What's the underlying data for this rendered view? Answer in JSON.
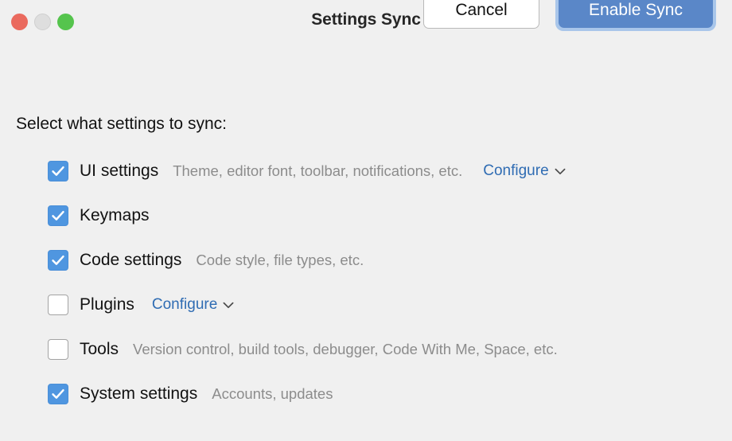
{
  "window": {
    "title": "Settings Sync",
    "traffic_lights": [
      {
        "name": "close",
        "color": "#ea6a5e"
      },
      {
        "name": "minimize",
        "color": "#dedede"
      },
      {
        "name": "zoom",
        "color": "#55c44d"
      }
    ]
  },
  "main": {
    "prompt": "Select what settings to sync:",
    "rows": [
      {
        "label": "UI settings",
        "checked": true,
        "description": "Theme, editor font, toolbar, notifications, etc.",
        "configure_label": "Configure",
        "configure_position": "right"
      },
      {
        "label": "Keymaps",
        "checked": true,
        "description": "",
        "configure_label": "",
        "configure_position": ""
      },
      {
        "label": "Code settings",
        "checked": true,
        "description": "Code style, file types, etc.",
        "configure_label": "",
        "configure_position": ""
      },
      {
        "label": "Plugins",
        "checked": false,
        "description": "",
        "configure_label": "Configure",
        "configure_position": "inline"
      },
      {
        "label": "Tools",
        "checked": false,
        "description": "Version control, build tools, debugger, Code With Me, Space, etc.",
        "configure_label": "",
        "configure_position": ""
      },
      {
        "label": "System settings",
        "checked": true,
        "description": "Accounts, updates",
        "configure_label": "",
        "configure_position": ""
      }
    ]
  },
  "footer": {
    "cancel_label": "Cancel",
    "primary_label": "Enable Sync"
  },
  "colors": {
    "background": "#f0f0f0",
    "checkbox_checked": "#4f96e0",
    "link": "#2f6cb3",
    "primary_button": "#5a87c8",
    "primary_focus_ring": "#a9c6ea",
    "description_text": "#8c8c8c"
  }
}
